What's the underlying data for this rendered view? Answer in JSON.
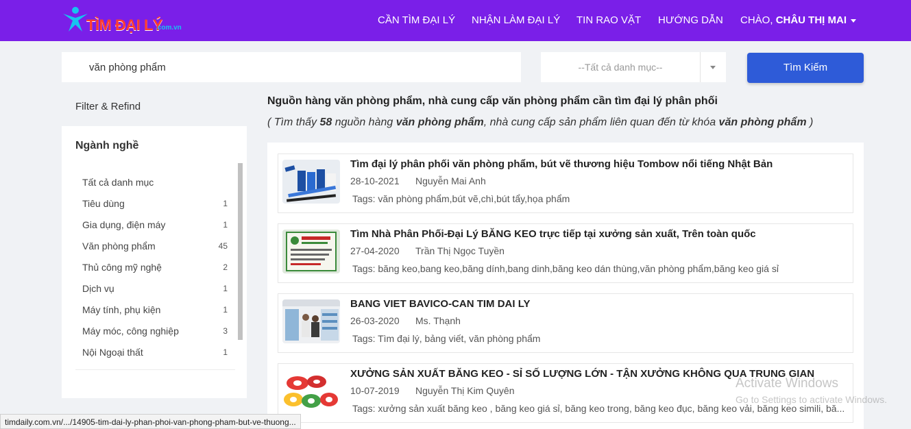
{
  "header": {
    "logo_text": "TÌM ĐẠI LÝ",
    "logo_sub": ".com.vn",
    "nav": [
      {
        "label": "CẦN TÌM ĐẠI LÝ"
      },
      {
        "label": "NHẬN LÀM ĐẠI LÝ"
      },
      {
        "label": "TIN RAO VẶT"
      },
      {
        "label": "HƯỚNG DẪN"
      }
    ],
    "greeting": "CHÀO,",
    "user_name": "CHÂU THỊ MAI"
  },
  "search": {
    "query": "văn phòng phẩm",
    "category_value": "--Tất cả danh mục--",
    "button_label": "Tìm Kiếm"
  },
  "sidebar": {
    "filter_title": "Filter & Refind",
    "heading": "Ngành nghề",
    "categories": [
      {
        "label": "Tất cả danh mục",
        "count": ""
      },
      {
        "label": "Tiêu dùng",
        "count": "1"
      },
      {
        "label": "Gia dụng, điện máy",
        "count": "1"
      },
      {
        "label": "Văn phòng phẩm",
        "count": "45"
      },
      {
        "label": "Thủ công mỹ nghệ",
        "count": "2"
      },
      {
        "label": "Dịch vụ",
        "count": "1"
      },
      {
        "label": "Máy tính, phụ kiện",
        "count": "1"
      },
      {
        "label": "Máy móc, công nghiệp",
        "count": "3"
      },
      {
        "label": "Nội Ngoại thất",
        "count": "1"
      }
    ]
  },
  "results": {
    "title": "Nguồn hàng văn phòng phẩm, nhà cung cấp văn phòng phẩm cần tìm đại lý phân phối",
    "sub_prefix": "( Tìm thấy",
    "count": "58",
    "sub_mid1": "nguồn hàng",
    "keyword": "văn phòng phẩm",
    "sub_mid2": ", nhà cung cấp sản phẩm liên quan đến từ khóa",
    "sub_suffix": ")",
    "items": [
      {
        "title": "Tìm đại lý phân phối văn phòng phẩm, bút vẽ thương hiệu Tombow nổi tiếng Nhật Bản",
        "date": "28-10-2021",
        "author": "Nguyễn Mai Anh",
        "tags": "Tags: văn phòng phẩm,bút vẽ,chì,bút tẩy,họa phẩm"
      },
      {
        "title": "Tìm Nhà Phân Phối-Đại Lý BĂNG KEO trực tiếp tại xưởng sản xuất, Trên toàn quốc",
        "date": "27-04-2020",
        "author": "Trần Thị Ngọc Tuyền",
        "tags": "Tags: băng keo,bang keo,băng dính,bang dinh,băng keo dán thùng,văn phòng phẩm,băng keo giá sỉ"
      },
      {
        "title": "BANG VIET BAVICO-CAN TIM DAI LY",
        "date": "26-03-2020",
        "author": "Ms. Thạnh",
        "tags": "Tags: Tìm đại lý, bảng viết, văn phòng phẩm"
      },
      {
        "title": "XƯỞNG SẢN XUẤT BĂNG KEO - SỈ SỐ LƯỢNG LỚN - TẬN XƯỞNG KHÔNG QUA TRUNG GIAN",
        "date": "10-07-2019",
        "author": "Nguyễn Thị Kim Quyên",
        "tags": "Tags: xưởng sản xuất băng keo , băng keo giá sỉ, băng keo trong, băng keo đục, băng keo vải, băng keo simili, bă..."
      }
    ]
  },
  "overlay": {
    "watermark_title": "Activate Windows",
    "watermark_sub": "Go to Settings to activate Windows.",
    "status_url": "timdaily.com.vn/.../14905-tim-dai-ly-phan-phoi-van-phong-pham-but-ve-thuong..."
  },
  "colors": {
    "header_bg": "#7a1fe8",
    "button_bg": "#2e5bd8",
    "page_bg": "#f0f2f5"
  }
}
